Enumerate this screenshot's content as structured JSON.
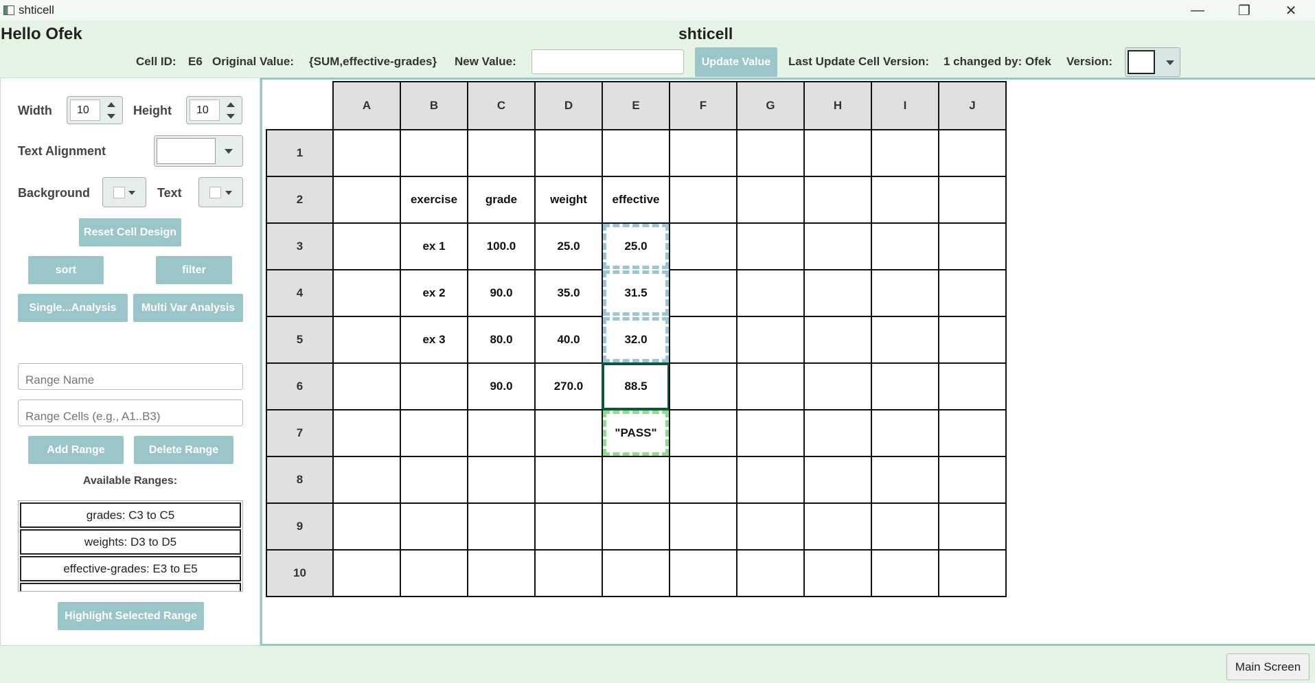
{
  "window": {
    "title": "shticell",
    "minimize_glyph": "—",
    "maximize_glyph": "❐",
    "close_glyph": "✕"
  },
  "header": {
    "greeting": "Hello Ofek",
    "app_title": "shticell",
    "cell_id_label": "Cell ID:",
    "cell_id_value": "E6",
    "original_value_label": "Original Value:",
    "original_value": "{SUM,effective-grades}",
    "new_value_label": "New Value:",
    "new_value": "",
    "update_button": "Update Value",
    "last_update_label": "Last Update Cell Version:",
    "last_update_value": "1 changed by: Ofek",
    "version_label": "Version:",
    "version_value": ""
  },
  "left_panel": {
    "width_label": "Width",
    "width_value": "10",
    "height_label": "Height",
    "height_value": "10",
    "text_alignment_label": "Text Alignment",
    "text_alignment_value": "",
    "background_label": "Background",
    "text_color_label": "Text",
    "reset_button": "Reset Cell Design",
    "sort_button": "sort",
    "filter_button": "filter",
    "single_analysis_button": "Single...Analysis",
    "multi_analysis_button": "Multi Var Analysis",
    "range_name_placeholder": "Range Name",
    "range_cells_placeholder": "Range Cells (e.g., A1..B3)",
    "add_range_button": "Add Range",
    "delete_range_button": "Delete Range",
    "available_ranges_label": "Available Ranges:",
    "ranges": [
      "grades: C3 to C5",
      "weights: D3 to D5",
      "effective-grades: E3 to E5"
    ],
    "highlight_button": "Highlight Selected Range"
  },
  "sheet": {
    "columns": [
      "A",
      "B",
      "C",
      "D",
      "E",
      "F",
      "G",
      "H",
      "I",
      "J"
    ],
    "rows": [
      "1",
      "2",
      "3",
      "4",
      "5",
      "6",
      "7",
      "8",
      "9",
      "10"
    ],
    "cells": [
      [
        "",
        "",
        "",
        "",
        "",
        "",
        "",
        "",
        "",
        ""
      ],
      [
        "",
        "exercise",
        "grade",
        "weight",
        "effective",
        "",
        "",
        "",
        "",
        ""
      ],
      [
        "",
        "ex 1",
        "100.0",
        "25.0",
        "25.0",
        "",
        "",
        "",
        "",
        ""
      ],
      [
        "",
        "ex 2",
        "90.0",
        "35.0",
        "31.5",
        "",
        "",
        "",
        "",
        ""
      ],
      [
        "",
        "ex 3",
        "80.0",
        "40.0",
        "32.0",
        "",
        "",
        "",
        "",
        ""
      ],
      [
        "",
        "",
        "90.0",
        "270.0",
        "88.5",
        "",
        "",
        "",
        "",
        ""
      ],
      [
        "",
        "",
        "",
        "",
        "\"PASS\"",
        "",
        "",
        "",
        "",
        ""
      ],
      [
        "",
        "",
        "",
        "",
        "",
        "",
        "",
        "",
        "",
        ""
      ],
      [
        "",
        "",
        "",
        "",
        "",
        "",
        "",
        "",
        "",
        ""
      ],
      [
        "",
        "",
        "",
        "",
        "",
        "",
        "",
        "",
        "",
        ""
      ]
    ],
    "selected_cell": "E6",
    "dependency_cells": [
      "E3",
      "E4",
      "E5"
    ],
    "influenced_cells": [
      "E7"
    ],
    "colors": {
      "selected": "#0a5a3a",
      "dependency": "#9ac5d6",
      "influenced": "#8fdc8f"
    }
  },
  "footer": {
    "main_screen_button": "Main Screen"
  }
}
